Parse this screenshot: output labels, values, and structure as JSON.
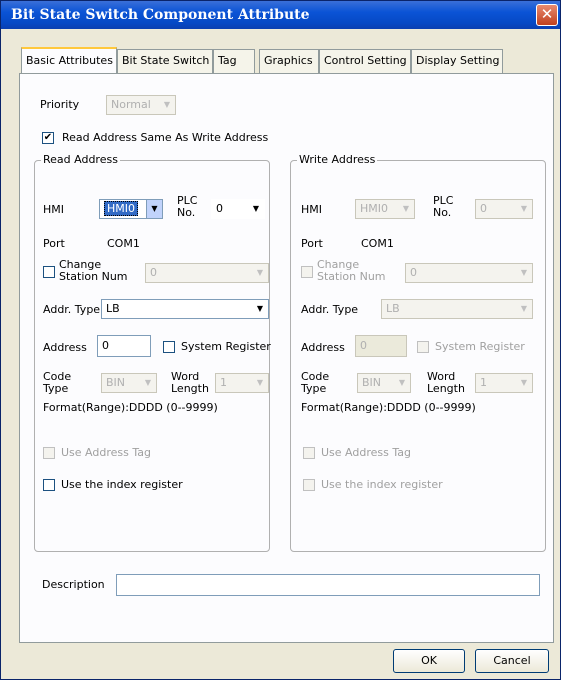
{
  "window": {
    "title": "Bit State Switch Component Attribute",
    "close_glyph": "✕"
  },
  "tabs": [
    {
      "label": "Basic Attributes"
    },
    {
      "label": "Bit State Switch"
    },
    {
      "label": "Tag"
    },
    {
      "label": "Graphics"
    },
    {
      "label": "Control Setting"
    },
    {
      "label": "Display Setting"
    }
  ],
  "priority": {
    "label": "Priority",
    "value": "Normal"
  },
  "read_same_as_write": {
    "label": "Read Address Same As Write Address",
    "checked_glyph": "✔"
  },
  "read": {
    "group_title": "Read Address",
    "hmi_label": "HMI",
    "hmi_value": "HMI0",
    "plc_label_1": "PLC",
    "plc_label_2": "No.",
    "plc_value": "0",
    "port_label": "Port",
    "port_value": "COM1",
    "change_station_1": "Change",
    "change_station_2": "Station Num",
    "station_value": "0",
    "addr_type_label": "Addr. Type",
    "addr_type_value": "LB",
    "address_label": "Address",
    "address_value": "0",
    "system_register_label": "System Register",
    "code_label_1": "Code",
    "code_label_2": "Type",
    "code_value": "BIN",
    "word_label_1": "Word",
    "word_label_2": "Length",
    "word_value": "1",
    "format": "Format(Range):DDDD (0--9999)",
    "use_address_tag": "Use Address Tag",
    "use_index_register": "Use the index register"
  },
  "write": {
    "group_title": "Write Address",
    "hmi_label": "HMI",
    "hmi_value": "HMI0",
    "plc_label_1": "PLC",
    "plc_label_2": "No.",
    "plc_value": "0",
    "port_label": "Port",
    "port_value": "COM1",
    "change_station_1": "Change",
    "change_station_2": "Station Num",
    "station_value": "0",
    "addr_type_label": "Addr. Type",
    "addr_type_value": "LB",
    "address_label": "Address",
    "address_value": "0",
    "system_register_label": "System Register",
    "code_label_1": "Code",
    "code_label_2": "Type",
    "code_value": "BIN",
    "word_label_1": "Word",
    "word_label_2": "Length",
    "word_value": "1",
    "format": "Format(Range):DDDD (0--9999)",
    "use_address_tag": "Use Address Tag",
    "use_index_register": "Use the index register"
  },
  "description": {
    "label": "Description",
    "value": ""
  },
  "buttons": {
    "ok": "OK",
    "cancel": "Cancel"
  },
  "icons": {
    "dropdown_arrow": "▼"
  }
}
